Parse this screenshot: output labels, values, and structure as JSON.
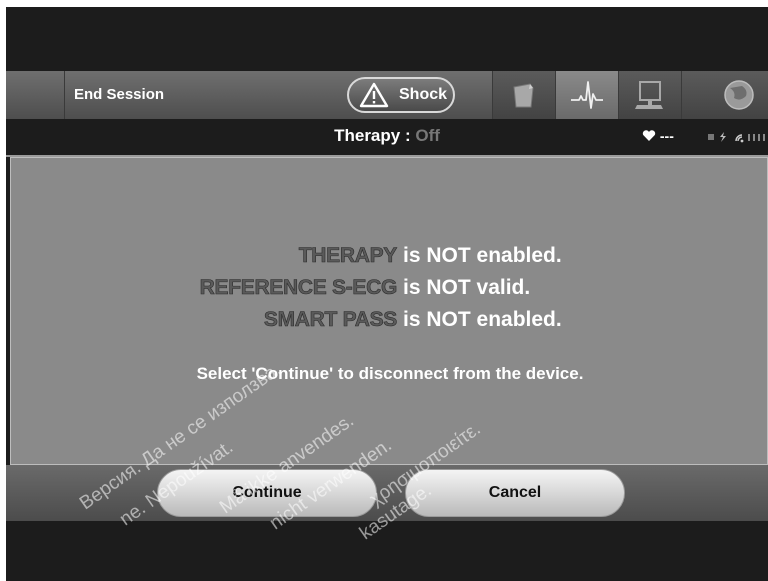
{
  "toolbar": {
    "end_session": "End Session",
    "shock": "Shock",
    "tabs": [
      {
        "icon": "document-icon",
        "active": false
      },
      {
        "icon": "ecg-waveform-icon",
        "active": true
      },
      {
        "icon": "monitor-icon",
        "active": false
      },
      {
        "icon": "globe-icon",
        "active": false
      }
    ]
  },
  "status": {
    "therapy_label": "Therapy :",
    "therapy_value": "Off",
    "heart_rate": "---"
  },
  "messages": [
    {
      "key": "THERAPY",
      "value": "is NOT enabled."
    },
    {
      "key": "REFERENCE S-ECG",
      "value": "is NOT valid."
    },
    {
      "key": "SMART PASS",
      "value": "is NOT enabled."
    }
  ],
  "instruction": "Select 'Continue' to disconnect from the device.",
  "buttons": {
    "continue": "Continue",
    "cancel": "Cancel"
  },
  "watermark": [
    "Версия. Да не се използва.",
    "ne. Nepoužívat.",
    "Må ikke anvendes.",
    "nicht verwenden.",
    "kasutage.",
    "χρησιμοποιείτε."
  ],
  "colors": {
    "panel": "#8a8a8a",
    "therapy_off": "#777777"
  }
}
